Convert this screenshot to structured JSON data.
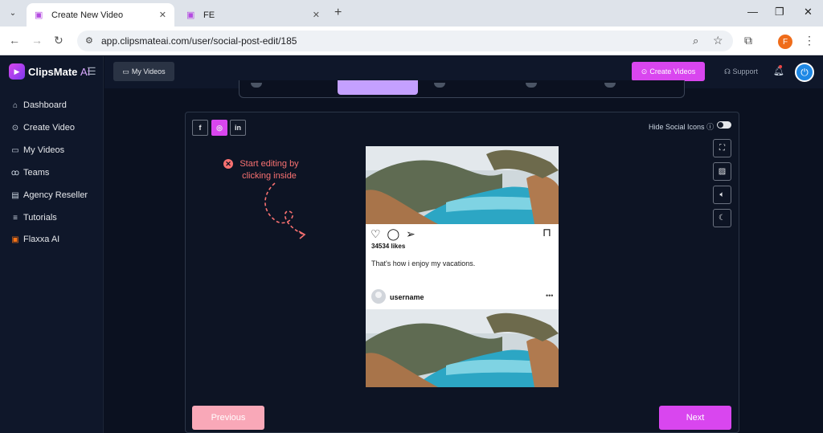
{
  "browser": {
    "tabs": [
      {
        "title": "Create New Video",
        "active": true
      },
      {
        "title": "FE",
        "active": false
      }
    ],
    "url": "app.clipsmateai.com/user/social-post-edit/185",
    "profile_initial": "F"
  },
  "app": {
    "brand": "ClipsMate",
    "brand_suffix": "AI",
    "accent": "#d946ef",
    "sidebar": {
      "items": [
        {
          "label": "Dashboard",
          "icon": "home-icon"
        },
        {
          "label": "Create Video",
          "icon": "play-circle-icon"
        },
        {
          "label": "My Videos",
          "icon": "video-camera-icon"
        },
        {
          "label": "Teams",
          "icon": "users-icon"
        },
        {
          "label": "Agency Reseller",
          "icon": "briefcase-icon"
        },
        {
          "label": "Tutorials",
          "icon": "sliders-icon"
        },
        {
          "label": "Flaxxa AI",
          "icon": "flaxxa-icon"
        }
      ]
    },
    "header": {
      "my_videos": "My Videos",
      "create_videos": "Create Videos",
      "support": "Support"
    }
  },
  "editor": {
    "social_tabs": [
      {
        "name": "facebook",
        "glyph": "f",
        "active": false
      },
      {
        "name": "instagram",
        "glyph": "◎",
        "active": true
      },
      {
        "name": "linkedin",
        "glyph": "in",
        "active": false
      }
    ],
    "hide_social_icons_label": "Hide Social Icons",
    "hint": "Start editing by clicking inside",
    "post": {
      "likes": "34534 likes",
      "caption": "That's how i enjoy my vacations.",
      "username": "username"
    },
    "previous_label": "Previous",
    "next_label": "Next"
  }
}
